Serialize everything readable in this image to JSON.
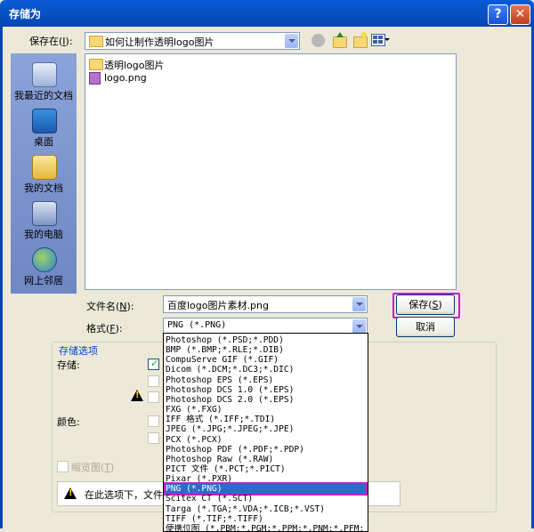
{
  "window": {
    "title": "存储为",
    "help_glyph": "?",
    "close_glyph": "✕"
  },
  "save_in": {
    "label": "保存在",
    "hotkey": "I",
    "value": "如何让制作透明logo图片"
  },
  "places": [
    {
      "label": "我最近的文档",
      "icon": "recent-documents-icon"
    },
    {
      "label": "桌面",
      "icon": "desktop-icon"
    },
    {
      "label": "我的文档",
      "icon": "my-documents-icon"
    },
    {
      "label": "我的电脑",
      "icon": "my-computer-icon"
    },
    {
      "label": "网上邻居",
      "icon": "network-places-icon"
    }
  ],
  "files": [
    {
      "name": "透明logo图片",
      "type": "folder"
    },
    {
      "name": "logo.png",
      "type": "png"
    }
  ],
  "filename": {
    "label": "文件名",
    "hotkey": "N",
    "value": "百度logo图片素材.png"
  },
  "format": {
    "label": "格式",
    "hotkey": "F",
    "value": "PNG (*.PNG)"
  },
  "buttons": {
    "save": "保存",
    "save_hotkey": "S",
    "cancel": "取消"
  },
  "options": {
    "group_title": "存储选项",
    "store_label": "存储:",
    "color_label": "颜色:",
    "thumbnail_label": "缩览图",
    "thumbnail_hotkey": "T",
    "info_text": "在此选项下，文件"
  },
  "format_list": [
    "Photoshop (*.PSD;*.PDD)",
    "BMP (*.BMP;*.RLE;*.DIB)",
    "CompuServe GIF (*.GIF)",
    "Dicom (*.DCM;*.DC3;*.DIC)",
    "Photoshop EPS (*.EPS)",
    "Photoshop DCS 1.0 (*.EPS)",
    "Photoshop DCS 2.0 (*.EPS)",
    "FXG (*.FXG)",
    "IFF 格式 (*.IFF;*.TDI)",
    "JPEG (*.JPG;*.JPEG;*.JPE)",
    "PCX (*.PCX)",
    "Photoshop PDF (*.PDF;*.PDP)",
    "Photoshop Raw (*.RAW)",
    "PICT 文件 (*.PCT;*.PICT)",
    "Pixar (*.PXR)",
    "PNG (*.PNG)",
    "Scitex CT (*.SCT)",
    "Targa (*.TGA;*.VDA;*.ICB;*.VST)",
    "TIFF (*.TIF;*.TIFF)",
    "便携位图 (*.PBM;*.PGM;*.PPM;*.PNM;*.PFM;"
  ],
  "format_selected_index": 15,
  "colors": {
    "titlebar": "#0753c6",
    "selection": "#316ac5",
    "highlight_outline": "#c41cd3"
  }
}
